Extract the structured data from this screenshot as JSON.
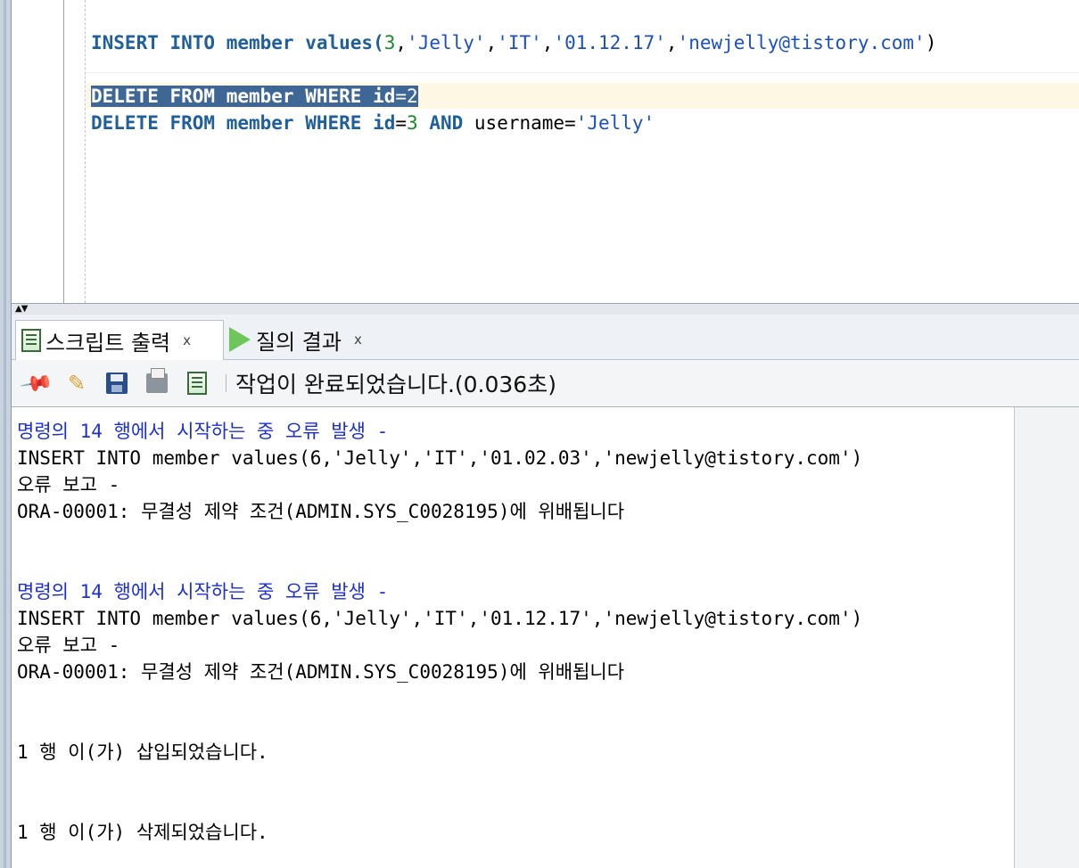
{
  "editor": {
    "lines": {
      "insert": {
        "kw1": "INSERT INTO member values(",
        "n1": "3",
        "c1": ",",
        "s1": "'Jelly'",
        "c2": ",",
        "s2": "'IT'",
        "c3": ",",
        "s3": "'01.12.17'",
        "c4": ",",
        "s4": "'newjelly@tistory.com'",
        "end": ")"
      },
      "delete1": {
        "kw": "DELETE FROM member WHERE id",
        "op": "=",
        "num": "2"
      },
      "delete2": {
        "kw": "DELETE FROM member WHERE id",
        "op": "=",
        "num": "3",
        "kw2": " AND ",
        "id2": "username=",
        "str": "'Jelly'"
      }
    }
  },
  "tabs": [
    {
      "label": "스크립트 출력",
      "close": "x",
      "icon": "script-output-icon"
    },
    {
      "label": "질의 결과",
      "close": "x",
      "icon": "run-query-icon"
    }
  ],
  "toolbar": {
    "buttons": [
      "pin-icon",
      "eraser-icon",
      "save-icon",
      "print-icon",
      "script-icon"
    ],
    "status": "작업이 완료되었습니다.(0.036초)"
  },
  "output": {
    "lines": [
      "명령의 14 행에서 시작하는 중 오류 발생 -",
      "INSERT INTO member values(6,'Jelly','IT','01.02.03','newjelly@tistory.com')",
      "오류 보고 -",
      "ORA-00001: 무결성 제약 조건(ADMIN.SYS_C0028195)에 위배됩니다",
      "명령의 14 행에서 시작하는 중 오류 발생 -",
      "INSERT INTO member values(6,'Jelly','IT','01.12.17','newjelly@tistory.com')",
      "오류 보고 -",
      "ORA-00001: 무결성 제약 조건(ADMIN.SYS_C0028195)에 위배됩니다",
      "1 행 이(가) 삽입되었습니다.",
      "1 행 이(가) 삭제되었습니다."
    ]
  },
  "colors": {
    "keyword": "#1f5f9b",
    "string": "#1a4fc6",
    "number": "#1a8a2a",
    "selection": "#3e6796",
    "error_header": "#1c2fd6"
  }
}
